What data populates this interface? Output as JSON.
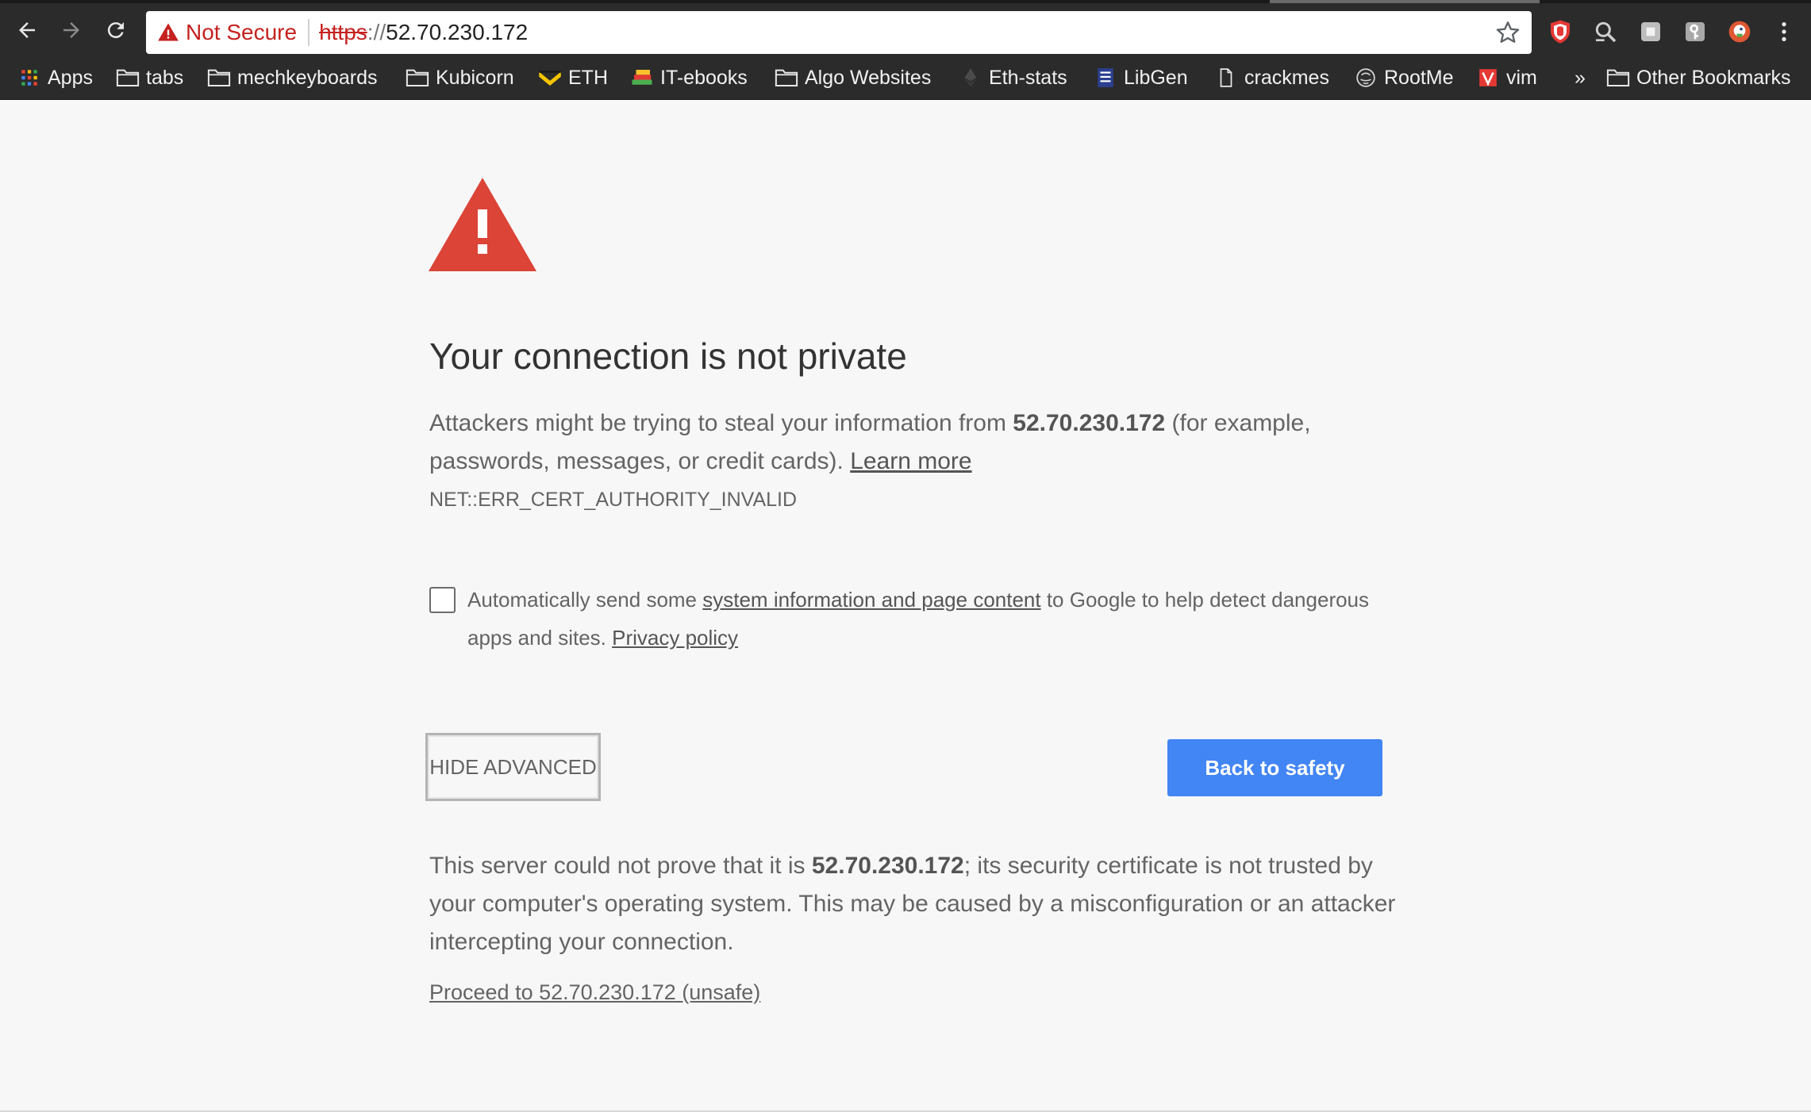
{
  "colors": {
    "chrome_dark": "#2b2b2b",
    "page_background": "#f7f7f7",
    "danger": "#c5221f",
    "warning_triangle": "#db4437",
    "primary_button": "#4285f4",
    "body_text": "#646464"
  },
  "toolbar": {
    "back_icon": "arrow-left-icon",
    "forward_icon": "arrow-right-icon",
    "reload_icon": "reload-icon",
    "omnibox": {
      "security_icon": "warning-triangle-icon",
      "security_label": "Not Secure",
      "scheme": "https",
      "scheme_separator": "://",
      "host": "52.70.230.172",
      "bookmark_icon": "star-icon"
    },
    "extensions": [
      "ublock-icon",
      "magnifier-icon",
      "evernote-icon",
      "key-icon",
      "duckduckgo-icon",
      "menu-dots-icon"
    ]
  },
  "bookmarks": {
    "items": [
      {
        "label": "Apps",
        "icon": "apps-grid-icon"
      },
      {
        "label": "tabs",
        "icon": "folder-icon"
      },
      {
        "label": "mechkeyboards",
        "icon": "folder-icon"
      },
      {
        "label": "Kubicorn",
        "icon": "folder-icon"
      },
      {
        "label": "ETH",
        "icon": "eth-logo-icon"
      },
      {
        "label": "IT-ebooks",
        "icon": "books-icon"
      },
      {
        "label": "Algo Websites",
        "icon": "folder-icon"
      },
      {
        "label": "Eth-stats",
        "icon": "ethereum-icon"
      },
      {
        "label": "LibGen",
        "icon": "libgen-icon"
      },
      {
        "label": "crackmes",
        "icon": "page-icon"
      },
      {
        "label": "RootMe",
        "icon": "rootme-icon"
      },
      {
        "label": "vim",
        "icon": "vim-icon"
      }
    ],
    "overflow": "»",
    "other": {
      "label": "Other Bookmarks",
      "icon": "folder-icon"
    }
  },
  "interstitial": {
    "icon": "warning-triangle-icon",
    "heading": "Your connection is not private",
    "explanation": {
      "prefix": "Attackers might be trying to steal your information from ",
      "host": "52.70.230.172",
      "suffix": " (for example, passwords, messages, or credit cards). ",
      "learn_more": "Learn more"
    },
    "error_code": "NET::ERR_CERT_AUTHORITY_INVALID",
    "opt_in": {
      "checked": false,
      "prefix": "Automatically send some ",
      "link": "system information and page content",
      "middle": " to Google to help detect dangerous apps and sites. ",
      "privacy_link": "Privacy policy"
    },
    "hide_advanced_label": "HIDE ADVANCED",
    "back_to_safety_label": "Back to safety",
    "details": {
      "prefix": "This server could not prove that it is ",
      "host": "52.70.230.172",
      "suffix": "; its security certificate is not trusted by your computer's operating system. This may be caused by a misconfiguration or an attacker intercepting your connection."
    },
    "proceed_link": "Proceed to 52.70.230.172 (unsafe)"
  }
}
